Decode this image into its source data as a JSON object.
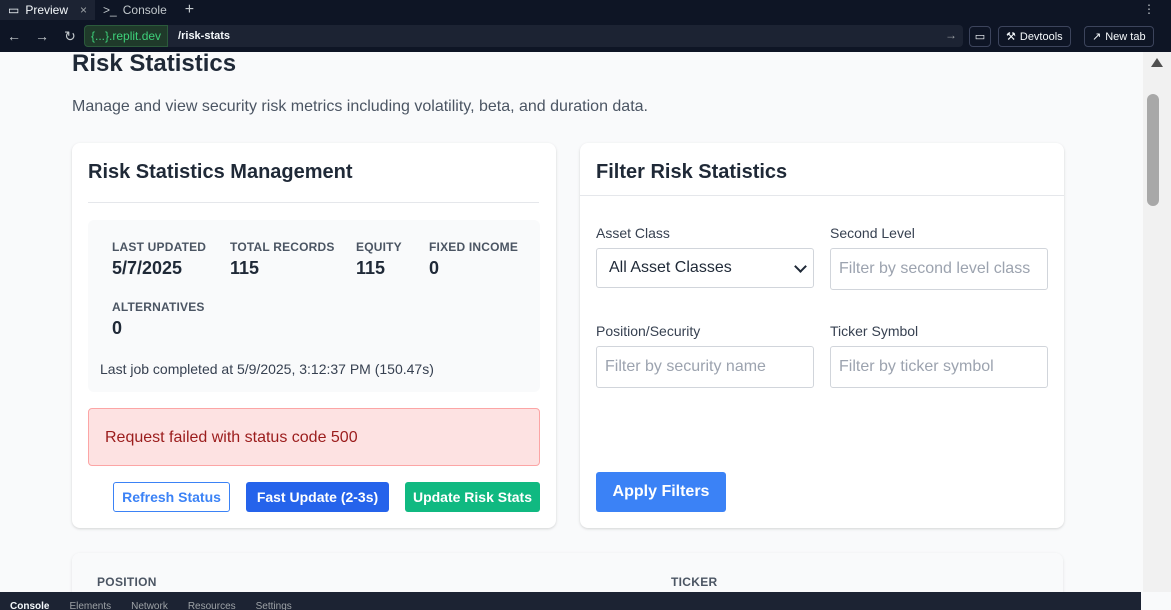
{
  "browser": {
    "tabs": [
      {
        "label": "Preview",
        "active": true
      },
      {
        "label": "Console",
        "active": false
      }
    ],
    "url_domain": "{...}.replit.dev",
    "url_path": "/risk-stats",
    "devtools_label": "Devtools",
    "new_tab_label": "New tab"
  },
  "page": {
    "title": "Risk Statistics",
    "description": "Manage and view security risk metrics including volatility, beta, and duration data."
  },
  "management": {
    "title": "Risk Statistics Management",
    "stats": [
      {
        "label": "LAST UPDATED",
        "value": "5/7/2025"
      },
      {
        "label": "TOTAL RECORDS",
        "value": "115"
      },
      {
        "label": "EQUITY",
        "value": "115"
      },
      {
        "label": "FIXED INCOME",
        "value": "0"
      },
      {
        "label": "ALTERNATIVES",
        "value": "0"
      }
    ],
    "last_job": "Last job completed at 5/9/2025, 3:12:37 PM (150.47s)",
    "error": "Request failed with status code 500",
    "buttons": {
      "refresh": "Refresh Status",
      "fast": "Fast Update (2-3s)",
      "update": "Update Risk Stats"
    }
  },
  "filter": {
    "title": "Filter Risk Statistics",
    "asset_class_label": "Asset Class",
    "asset_class_value": "All Asset Classes",
    "second_level_label": "Second Level",
    "second_level_placeholder": "Filter by second level class",
    "position_label": "Position/Security",
    "position_placeholder": "Filter by security name",
    "ticker_label": "Ticker Symbol",
    "ticker_placeholder": "Filter by ticker symbol",
    "apply_label": "Apply Filters"
  },
  "table": {
    "columns": [
      "POSITION",
      "TICKER"
    ]
  },
  "devtools": {
    "tabs": [
      "Console",
      "Elements",
      "Network",
      "Resources",
      "Settings"
    ]
  }
}
